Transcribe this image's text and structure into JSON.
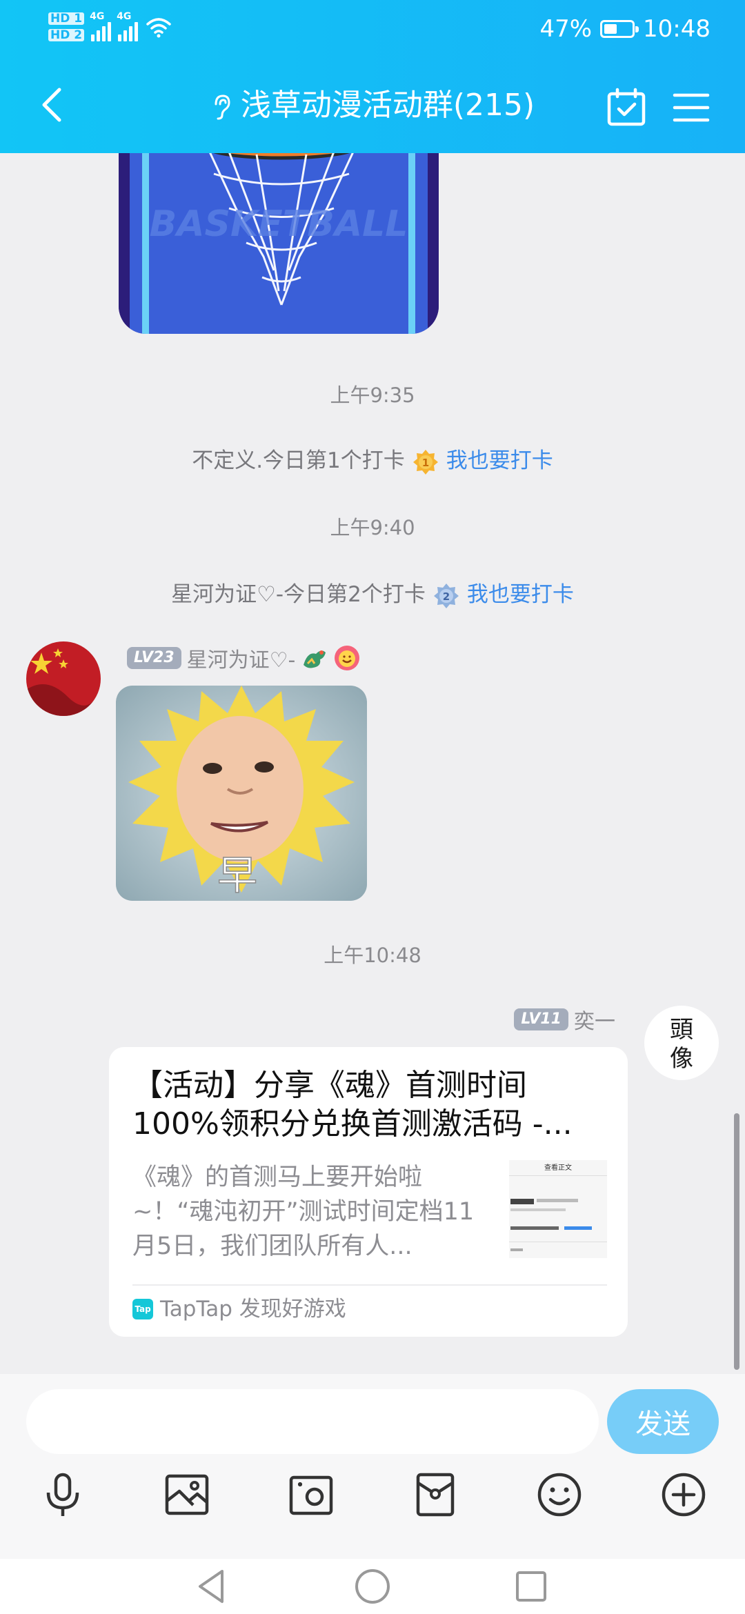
{
  "status_bar": {
    "hd1": "HD 1",
    "hd2": "HD 2",
    "net1": "4G",
    "net2": "4G",
    "battery": "47%",
    "battery_level": 0.47,
    "time": "10:48"
  },
  "header": {
    "title": "浅草动漫活动群(215)",
    "icons": [
      "back-arrow-icon",
      "ear-icon",
      "calendar-check-icon",
      "menu-icon"
    ]
  },
  "messages": {
    "time1": "上午9:35",
    "checkin1": {
      "text": "不定义.今日第1个打卡",
      "medal": "1",
      "link": "我也要打卡"
    },
    "time2": "上午9:40",
    "checkin2": {
      "text": "星河为证♡-今日第2个打卡",
      "medal": "2",
      "link": "我也要打卡"
    },
    "msg1": {
      "level": "LV23",
      "sender": "星河为证♡-",
      "sticker_text": "早"
    },
    "time3": "上午10:48",
    "msg2": {
      "level": "LV11",
      "sender": "奕一",
      "avatar_text": "頭像",
      "card": {
        "title_line1": "【活动】分享《魂》首测时间",
        "title_line2": "100%领积分兑换首测激活码 -...",
        "desc": "《魂》的首测马上要开始啦~！“魂沌初开”测试时间定档11月5日，我们团队所有人...",
        "thumb_title": "查看正文",
        "source": "TapTap 发现好游戏",
        "logo": "Tap"
      }
    }
  },
  "input": {
    "placeholder": "",
    "send_label": "发送",
    "tools": [
      "microphone-icon",
      "image-icon",
      "camera-icon",
      "red-packet-icon",
      "emoji-icon",
      "plus-icon"
    ]
  },
  "colors": {
    "header": "#12c5f6",
    "link": "#3b8bea",
    "send_button": "#77cdf8",
    "level_badge": "#a4acbb"
  }
}
